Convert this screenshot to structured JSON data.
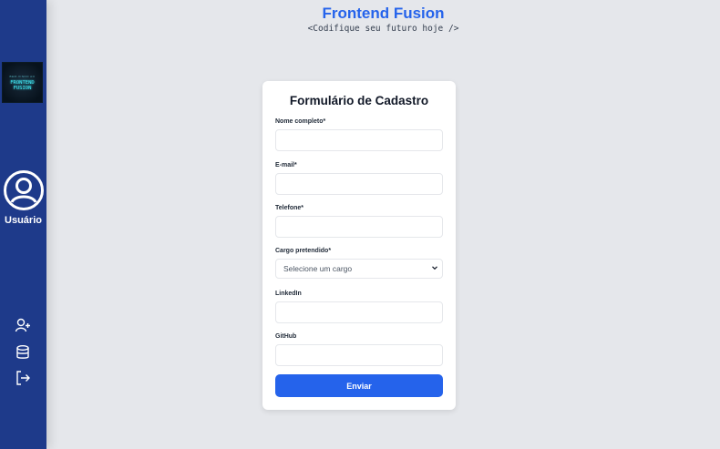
{
  "header": {
    "title": "Frontend Fusion",
    "subtitle": "<Codifique seu futuro hoje />"
  },
  "sidebar": {
    "logo": {
      "line_small": "BEM-VINDO AO",
      "line1": "FRONTEND",
      "line2": "FUSION"
    },
    "user_label": "Usuário",
    "icons": [
      "add-user-icon",
      "database-icon",
      "logout-icon"
    ]
  },
  "form": {
    "title": "Formulário de Cadastro",
    "fields": [
      {
        "label": "Nome completo*",
        "value": ""
      },
      {
        "label": "E-mail*",
        "value": ""
      },
      {
        "label": "Telefone*",
        "value": ""
      },
      {
        "label": "Cargo pretendido*",
        "selected": "Selecione um cargo"
      },
      {
        "label": "LinkedIn",
        "value": ""
      },
      {
        "label": "GitHub",
        "value": ""
      }
    ],
    "submit_label": "Enviar"
  },
  "colors": {
    "sidebar": "#1e3a8a",
    "accent": "#2563eb",
    "background": "#e5e7eb"
  }
}
